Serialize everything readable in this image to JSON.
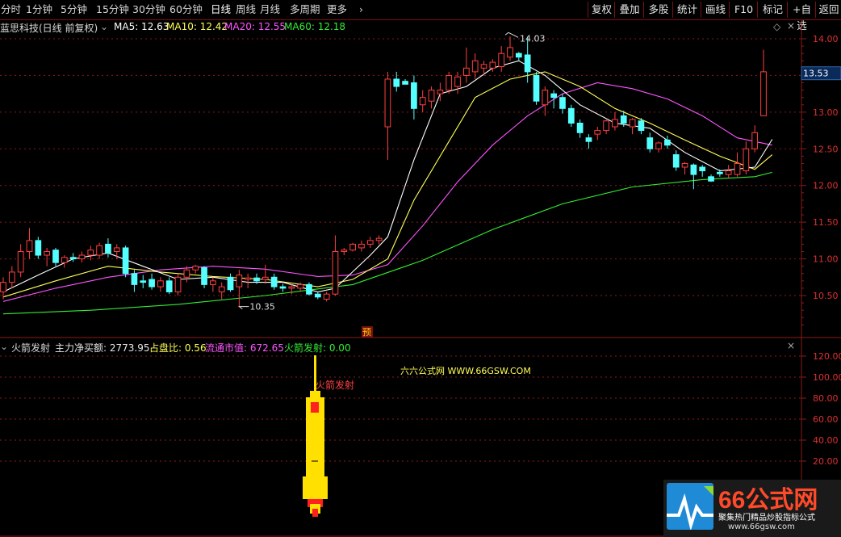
{
  "toolbar": {
    "periods": [
      {
        "label": "分时",
        "active": false
      },
      {
        "label": "1分钟",
        "active": false
      },
      {
        "label": "5分钟",
        "active": false
      },
      {
        "label": "15分钟",
        "active": false
      },
      {
        "label": "30分钟",
        "active": false
      },
      {
        "label": "60分钟",
        "active": false
      },
      {
        "label": "日线",
        "active": true
      },
      {
        "label": "周线",
        "active": false
      },
      {
        "label": "月线",
        "active": false
      },
      {
        "label": "多周期",
        "active": false
      },
      {
        "label": "更多",
        "active": false
      }
    ],
    "more_chevron": "›",
    "right_buttons": [
      "复权",
      "叠加",
      "多股",
      "统计",
      "画线",
      "F10",
      "标记",
      "+自选",
      "返回"
    ]
  },
  "main_panel": {
    "title": "蓝思科技(日线 前复权)",
    "indicators": [
      {
        "label": "MA5: 12.63",
        "color": "#ffffff"
      },
      {
        "label": "MA10: 12.42",
        "color": "#ffff55"
      },
      {
        "label": "MA20: 12.55",
        "color": "#ff55ff"
      },
      {
        "label": "MA60: 12.18",
        "color": "#33ee33"
      }
    ],
    "price_ticks": [
      "14.00",
      "13.50",
      "13.00",
      "12.50",
      "12.00",
      "11.50",
      "11.00",
      "10.50"
    ],
    "current_price": "13.53",
    "high_label": "14.03",
    "low_label": "10.35",
    "forecast_badge": "预"
  },
  "sub_panel": {
    "title": "火箭发射",
    "fields": [
      {
        "label": "主力净买额: 2773.95",
        "color": "#e6e6e6"
      },
      {
        "label": "占盘比: 0.56",
        "color": "#ffff55"
      },
      {
        "label": "流通市值: 672.65",
        "color": "#ff55ff"
      },
      {
        "label": "火箭发射: 0.00",
        "color": "#33ee33"
      }
    ],
    "ticks": [
      "120.00",
      "100.00",
      "80.00",
      "60.00",
      "40.00",
      "20.00"
    ],
    "watermark": "六六公式网 WWW.66GSW.COM",
    "rocket_label": "火箭发射"
  },
  "logo": {
    "brand": "66公式网",
    "slogan": "聚集热门精品炒股指标公式",
    "url": "www.66gsw.com"
  },
  "colors": {
    "up": "#ff4040",
    "down": "#54ffff",
    "ma5": "#ffffff",
    "ma10": "#ffff55",
    "ma20": "#ff55ff",
    "ma60": "#33ee33",
    "grid": "#8b1a1a",
    "rocket": "#ffe000"
  },
  "chart_data": {
    "type": "candlestick",
    "y_range": [
      10.1,
      14.25
    ],
    "candles": [
      {
        "o": 10.55,
        "h": 10.75,
        "l": 10.45,
        "c": 10.68
      },
      {
        "o": 10.68,
        "h": 10.9,
        "l": 10.6,
        "c": 10.82
      },
      {
        "o": 10.82,
        "h": 11.2,
        "l": 10.75,
        "c": 11.1
      },
      {
        "o": 11.1,
        "h": 11.42,
        "l": 11.0,
        "c": 11.25
      },
      {
        "o": 11.25,
        "h": 11.3,
        "l": 11.0,
        "c": 11.05
      },
      {
        "o": 11.05,
        "h": 11.15,
        "l": 10.9,
        "c": 11.1
      },
      {
        "o": 11.12,
        "h": 11.15,
        "l": 10.9,
        "c": 10.95
      },
      {
        "o": 10.95,
        "h": 11.05,
        "l": 10.88,
        "c": 11.02
      },
      {
        "o": 11.02,
        "h": 11.08,
        "l": 10.96,
        "c": 11.0
      },
      {
        "o": 11.0,
        "h": 11.1,
        "l": 10.95,
        "c": 11.05
      },
      {
        "o": 11.05,
        "h": 11.18,
        "l": 10.98,
        "c": 11.12
      },
      {
        "o": 11.05,
        "h": 11.22,
        "l": 11.0,
        "c": 11.18
      },
      {
        "o": 11.2,
        "h": 11.28,
        "l": 11.02,
        "c": 11.08
      },
      {
        "o": 11.1,
        "h": 11.2,
        "l": 11.0,
        "c": 11.15
      },
      {
        "o": 11.15,
        "h": 11.18,
        "l": 10.75,
        "c": 10.8
      },
      {
        "o": 10.8,
        "h": 10.85,
        "l": 10.55,
        "c": 10.65
      },
      {
        "o": 10.7,
        "h": 10.78,
        "l": 10.6,
        "c": 10.68
      },
      {
        "o": 10.72,
        "h": 10.8,
        "l": 10.58,
        "c": 10.62
      },
      {
        "o": 10.62,
        "h": 10.75,
        "l": 10.55,
        "c": 10.7
      },
      {
        "o": 10.7,
        "h": 10.75,
        "l": 10.52,
        "c": 10.55
      },
      {
        "o": 10.55,
        "h": 10.8,
        "l": 10.5,
        "c": 10.75
      },
      {
        "o": 10.75,
        "h": 10.9,
        "l": 10.68,
        "c": 10.85
      },
      {
        "o": 10.85,
        "h": 10.92,
        "l": 10.8,
        "c": 10.9
      },
      {
        "o": 10.88,
        "h": 10.9,
        "l": 10.6,
        "c": 10.65
      },
      {
        "o": 10.65,
        "h": 10.75,
        "l": 10.55,
        "c": 10.7
      },
      {
        "o": 10.55,
        "h": 10.68,
        "l": 10.45,
        "c": 10.62
      },
      {
        "o": 10.75,
        "h": 10.8,
        "l": 10.55,
        "c": 10.58
      },
      {
        "o": 10.62,
        "h": 10.85,
        "l": 10.35,
        "c": 10.78
      },
      {
        "o": 10.72,
        "h": 10.8,
        "l": 10.6,
        "c": 10.74
      },
      {
        "o": 10.74,
        "h": 10.8,
        "l": 10.66,
        "c": 10.7
      },
      {
        "o": 10.72,
        "h": 10.92,
        "l": 10.66,
        "c": 10.75
      },
      {
        "o": 10.75,
        "h": 10.8,
        "l": 10.58,
        "c": 10.62
      },
      {
        "o": 10.62,
        "h": 10.66,
        "l": 10.55,
        "c": 10.6
      },
      {
        "o": 10.6,
        "h": 10.65,
        "l": 10.52,
        "c": 10.62
      },
      {
        "o": 10.6,
        "h": 10.68,
        "l": 10.55,
        "c": 10.65
      },
      {
        "o": 10.65,
        "h": 10.68,
        "l": 10.5,
        "c": 10.52
      },
      {
        "o": 10.52,
        "h": 10.55,
        "l": 10.45,
        "c": 10.48
      },
      {
        "o": 10.45,
        "h": 10.55,
        "l": 10.42,
        "c": 10.52
      },
      {
        "o": 10.52,
        "h": 11.32,
        "l": 10.5,
        "c": 11.1
      },
      {
        "o": 11.1,
        "h": 11.15,
        "l": 11.05,
        "c": 11.12
      },
      {
        "o": 11.12,
        "h": 11.22,
        "l": 11.1,
        "c": 11.2
      },
      {
        "o": 11.15,
        "h": 11.25,
        "l": 11.1,
        "c": 11.2
      },
      {
        "o": 11.2,
        "h": 11.3,
        "l": 11.15,
        "c": 11.25
      },
      {
        "o": 11.25,
        "h": 11.32,
        "l": 11.2,
        "c": 11.28
      },
      {
        "o": 12.8,
        "h": 13.55,
        "l": 12.35,
        "c": 13.45
      },
      {
        "o": 13.45,
        "h": 13.55,
        "l": 13.28,
        "c": 13.35
      },
      {
        "o": 13.42,
        "h": 13.45,
        "l": 13.38,
        "c": 13.38
      },
      {
        "o": 13.4,
        "h": 13.5,
        "l": 12.9,
        "c": 13.05
      },
      {
        "o": 13.1,
        "h": 13.3,
        "l": 13.0,
        "c": 13.2
      },
      {
        "o": 13.15,
        "h": 13.35,
        "l": 13.05,
        "c": 13.3
      },
      {
        "o": 13.25,
        "h": 13.4,
        "l": 13.15,
        "c": 13.3
      },
      {
        "o": 13.3,
        "h": 13.55,
        "l": 13.25,
        "c": 13.5
      },
      {
        "o": 13.35,
        "h": 13.55,
        "l": 13.25,
        "c": 13.48
      },
      {
        "o": 13.5,
        "h": 13.88,
        "l": 13.4,
        "c": 13.6
      },
      {
        "o": 13.55,
        "h": 13.8,
        "l": 13.45,
        "c": 13.7
      },
      {
        "o": 13.6,
        "h": 13.7,
        "l": 13.5,
        "c": 13.65
      },
      {
        "o": 13.6,
        "h": 13.72,
        "l": 13.55,
        "c": 13.68
      },
      {
        "o": 13.62,
        "h": 13.9,
        "l": 13.55,
        "c": 13.8
      },
      {
        "o": 13.75,
        "h": 14.03,
        "l": 13.7,
        "c": 13.88
      },
      {
        "o": 13.8,
        "h": 13.82,
        "l": 13.7,
        "c": 13.75
      },
      {
        "o": 13.78,
        "h": 14.03,
        "l": 13.4,
        "c": 13.55
      },
      {
        "o": 13.5,
        "h": 13.55,
        "l": 13.1,
        "c": 13.15
      },
      {
        "o": 13.1,
        "h": 13.35,
        "l": 12.95,
        "c": 13.3
      },
      {
        "o": 13.25,
        "h": 13.3,
        "l": 13.05,
        "c": 13.2
      },
      {
        "o": 13.2,
        "h": 13.25,
        "l": 12.98,
        "c": 13.05
      },
      {
        "o": 13.05,
        "h": 13.1,
        "l": 12.8,
        "c": 12.85
      },
      {
        "o": 12.85,
        "h": 12.9,
        "l": 12.65,
        "c": 12.72
      },
      {
        "o": 12.65,
        "h": 12.7,
        "l": 12.5,
        "c": 12.6
      },
      {
        "o": 12.7,
        "h": 12.8,
        "l": 12.62,
        "c": 12.75
      },
      {
        "o": 12.75,
        "h": 12.9,
        "l": 12.7,
        "c": 12.88
      },
      {
        "o": 12.8,
        "h": 13.0,
        "l": 12.75,
        "c": 12.9
      },
      {
        "o": 12.95,
        "h": 13.02,
        "l": 12.8,
        "c": 12.85
      },
      {
        "o": 12.8,
        "h": 12.92,
        "l": 12.7,
        "c": 12.9
      },
      {
        "o": 12.88,
        "h": 12.92,
        "l": 12.7,
        "c": 12.75
      },
      {
        "o": 12.65,
        "h": 12.72,
        "l": 12.45,
        "c": 12.5
      },
      {
        "o": 12.5,
        "h": 12.6,
        "l": 12.45,
        "c": 12.58
      },
      {
        "o": 12.62,
        "h": 12.68,
        "l": 12.5,
        "c": 12.55
      },
      {
        "o": 12.42,
        "h": 12.48,
        "l": 12.2,
        "c": 12.25
      },
      {
        "o": 12.25,
        "h": 12.32,
        "l": 12.15,
        "c": 12.3
      },
      {
        "o": 12.28,
        "h": 12.3,
        "l": 11.95,
        "c": 12.15
      },
      {
        "o": 12.25,
        "h": 12.28,
        "l": 12.12,
        "c": 12.2
      },
      {
        "o": 12.12,
        "h": 12.15,
        "l": 12.05,
        "c": 12.06
      },
      {
        "o": 12.18,
        "h": 12.22,
        "l": 12.12,
        "c": 12.16
      },
      {
        "o": 12.15,
        "h": 12.28,
        "l": 12.1,
        "c": 12.2
      },
      {
        "o": 12.15,
        "h": 12.45,
        "l": 12.12,
        "c": 12.3
      },
      {
        "o": 12.2,
        "h": 12.6,
        "l": 12.15,
        "c": 12.5
      },
      {
        "o": 12.5,
        "h": 12.82,
        "l": 12.45,
        "c": 12.72
      },
      {
        "o": 12.95,
        "h": 13.85,
        "l": 12.95,
        "c": 13.55
      }
    ],
    "ma5": [
      [
        0,
        10.55
      ],
      [
        4,
        10.78
      ],
      [
        8,
        11.0
      ],
      [
        12,
        11.08
      ],
      [
        16,
        10.9
      ],
      [
        20,
        10.72
      ],
      [
        24,
        10.75
      ],
      [
        28,
        10.68
      ],
      [
        32,
        10.68
      ],
      [
        36,
        10.55
      ],
      [
        38,
        10.6
      ],
      [
        42,
        11.05
      ],
      [
        44,
        11.3
      ],
      [
        47,
        12.35
      ],
      [
        50,
        13.25
      ],
      [
        53,
        13.35
      ],
      [
        56,
        13.6
      ],
      [
        59,
        13.7
      ],
      [
        62,
        13.5
      ],
      [
        66,
        13.1
      ],
      [
        70,
        12.85
      ],
      [
        74,
        12.78
      ],
      [
        78,
        12.45
      ],
      [
        82,
        12.2
      ],
      [
        86,
        12.25
      ],
      [
        88,
        12.63
      ]
    ],
    "ma10": [
      [
        0,
        10.48
      ],
      [
        6,
        10.7
      ],
      [
        12,
        10.9
      ],
      [
        18,
        10.82
      ],
      [
        24,
        10.76
      ],
      [
        30,
        10.72
      ],
      [
        36,
        10.62
      ],
      [
        40,
        10.72
      ],
      [
        44,
        11.0
      ],
      [
        47,
        11.8
      ],
      [
        51,
        12.6
      ],
      [
        54,
        13.2
      ],
      [
        58,
        13.45
      ],
      [
        62,
        13.55
      ],
      [
        66,
        13.35
      ],
      [
        70,
        13.05
      ],
      [
        74,
        12.85
      ],
      [
        78,
        12.62
      ],
      [
        82,
        12.4
      ],
      [
        86,
        12.22
      ],
      [
        88,
        12.42
      ]
    ],
    "ma20": [
      [
        0,
        10.42
      ],
      [
        6,
        10.6
      ],
      [
        12,
        10.75
      ],
      [
        18,
        10.85
      ],
      [
        24,
        10.9
      ],
      [
        30,
        10.86
      ],
      [
        36,
        10.76
      ],
      [
        40,
        10.78
      ],
      [
        44,
        10.92
      ],
      [
        48,
        11.45
      ],
      [
        52,
        12.05
      ],
      [
        56,
        12.55
      ],
      [
        60,
        12.95
      ],
      [
        64,
        13.25
      ],
      [
        68,
        13.4
      ],
      [
        72,
        13.32
      ],
      [
        76,
        13.18
      ],
      [
        80,
        12.95
      ],
      [
        84,
        12.65
      ],
      [
        88,
        12.55
      ]
    ],
    "ma60": [
      [
        0,
        10.25
      ],
      [
        10,
        10.3
      ],
      [
        20,
        10.38
      ],
      [
        30,
        10.5
      ],
      [
        40,
        10.65
      ],
      [
        48,
        10.98
      ],
      [
        56,
        11.4
      ],
      [
        64,
        11.75
      ],
      [
        72,
        11.98
      ],
      [
        80,
        12.08
      ],
      [
        86,
        12.12
      ],
      [
        88,
        12.18
      ]
    ],
    "sub_range": [
      0,
      130
    ],
    "rocket_x_index": 22
  }
}
